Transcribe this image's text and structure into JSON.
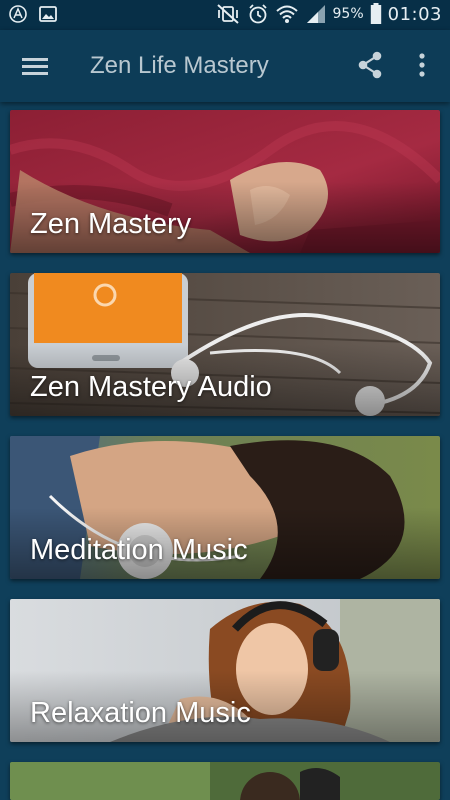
{
  "status_bar": {
    "battery": "95%",
    "time": "01:03"
  },
  "toolbar": {
    "title": "Zen Life Mastery"
  },
  "cards": [
    {
      "label": "Zen Mastery"
    },
    {
      "label": "Zen Mastery Audio"
    },
    {
      "label": "Meditation Music"
    },
    {
      "label": "Relaxation Music"
    }
  ],
  "icons": {
    "menu": "hamburger-icon",
    "share": "share-icon",
    "more": "more-vert-icon"
  }
}
